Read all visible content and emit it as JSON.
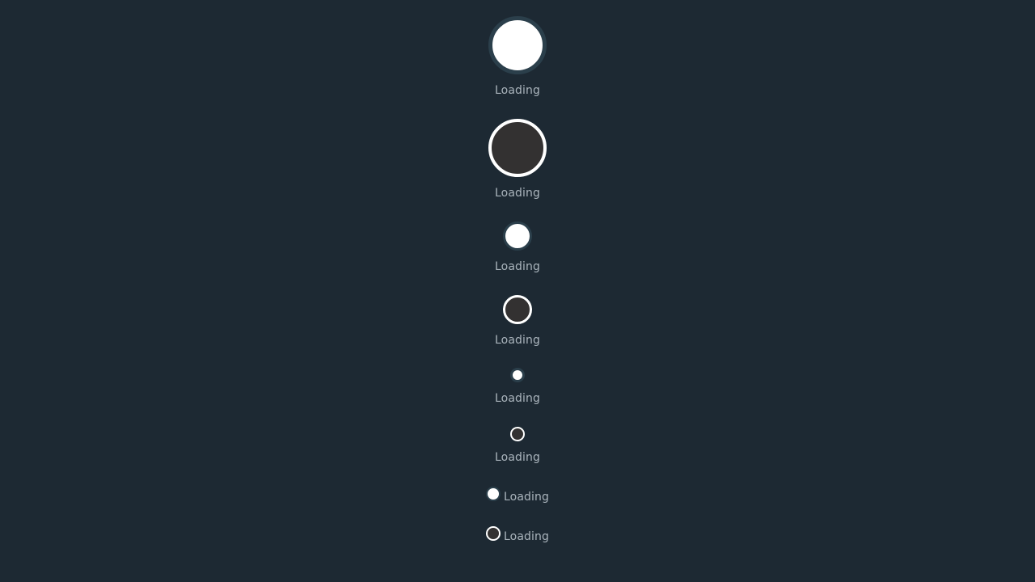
{
  "loaders": [
    {
      "label": "Loading",
      "variant": "light",
      "size": "xl"
    },
    {
      "label": "Loading",
      "variant": "dark",
      "size": "xl"
    },
    {
      "label": "Loading",
      "variant": "light",
      "size": "md"
    },
    {
      "label": "Loading",
      "variant": "dark",
      "size": "md"
    },
    {
      "label": "Loading",
      "variant": "light",
      "size": "sm"
    },
    {
      "label": "Loading",
      "variant": "dark",
      "size": "sm"
    },
    {
      "label": "Loading",
      "variant": "light",
      "size": "xs",
      "layout": "inline"
    },
    {
      "label": "Loading",
      "variant": "dark",
      "size": "xs",
      "layout": "inline"
    }
  ],
  "colors": {
    "background": "#1d2933",
    "light_fill": "#ffffff",
    "light_ring": "#2b3f4b",
    "dark_fill": "#333131",
    "dark_ring": "#ffffff",
    "label": "#aab4bc"
  }
}
